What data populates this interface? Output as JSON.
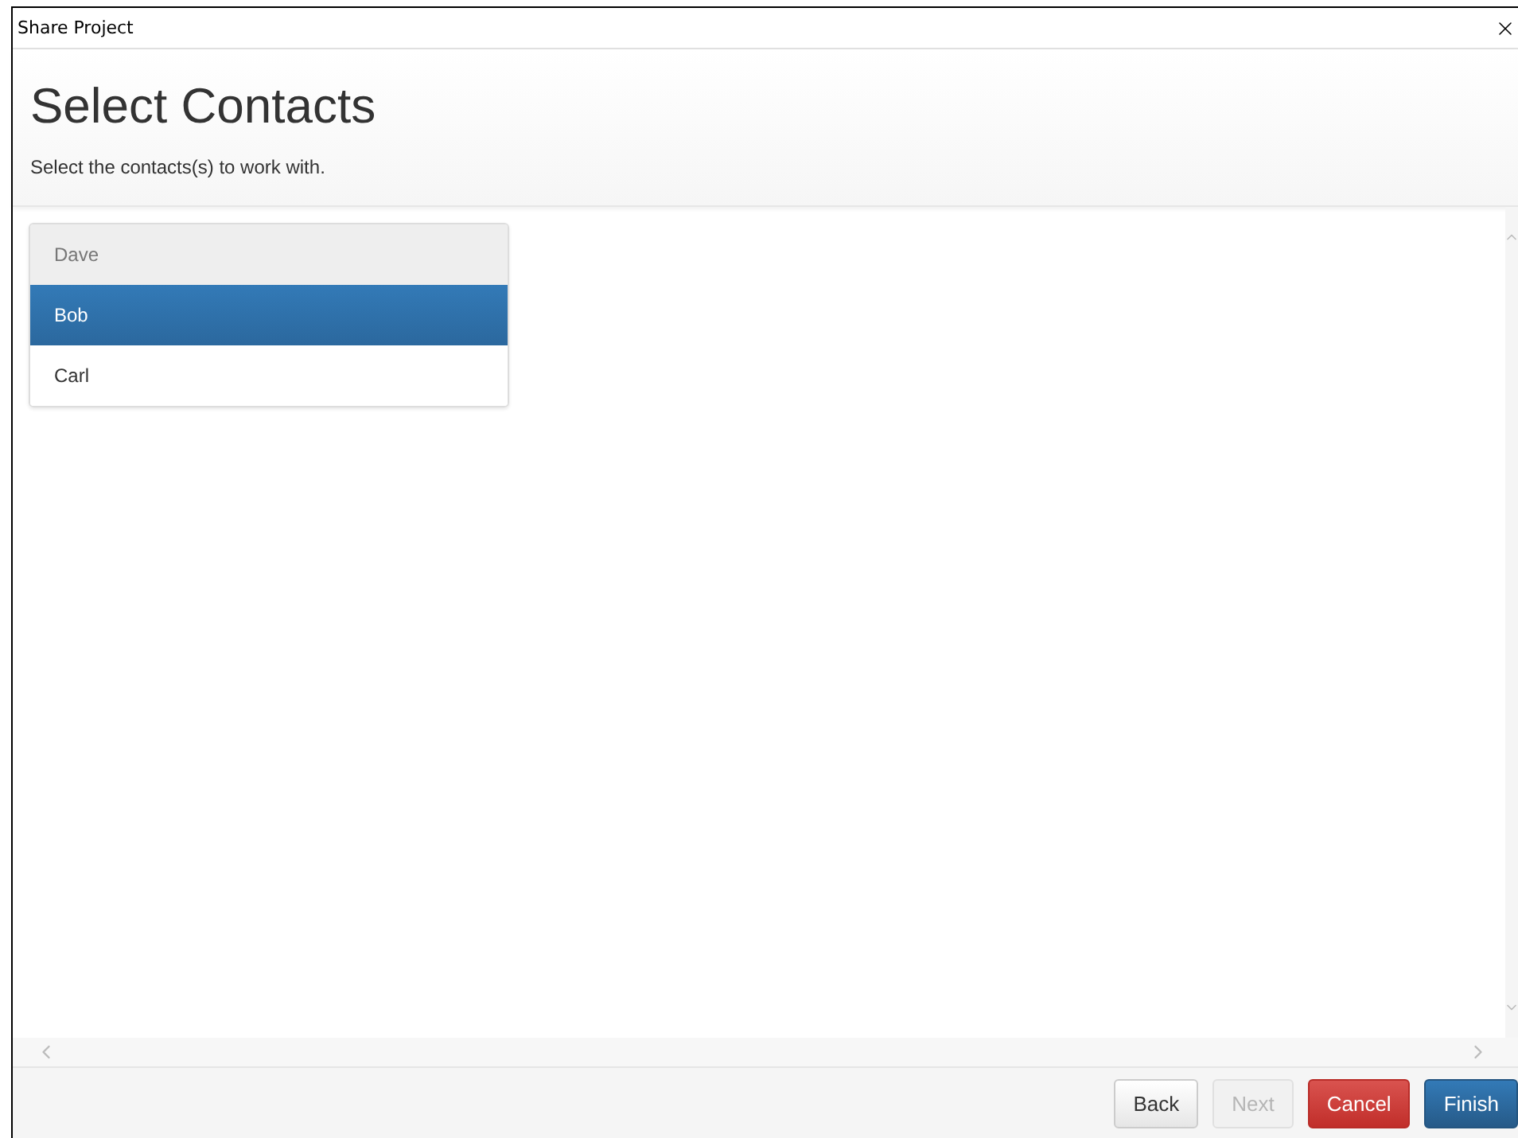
{
  "window": {
    "title": "Share Project"
  },
  "header": {
    "title": "Select Contacts",
    "subtitle": "Select the contacts(s) to work with."
  },
  "contacts": [
    {
      "name": "Dave",
      "selected": false,
      "disabled": true
    },
    {
      "name": "Bob",
      "selected": true,
      "disabled": false
    },
    {
      "name": "Carl",
      "selected": false,
      "disabled": false
    }
  ],
  "buttons": [
    {
      "label": "Back",
      "kind": "default",
      "disabled": false
    },
    {
      "label": "Next",
      "kind": "default",
      "disabled": true
    },
    {
      "label": "Cancel",
      "kind": "danger",
      "disabled": false
    },
    {
      "label": "Finish",
      "kind": "primary",
      "disabled": false
    }
  ]
}
